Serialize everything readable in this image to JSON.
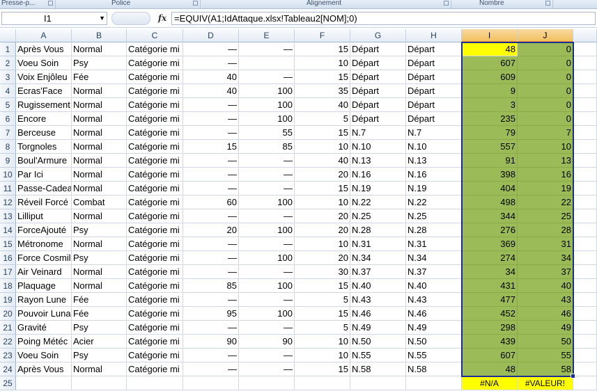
{
  "ribbon": {
    "groups": [
      {
        "label": "Presse-p...",
        "key": "clipboard"
      },
      {
        "label": "Police",
        "key": "font"
      },
      {
        "label": "Alignement",
        "key": "alignment"
      },
      {
        "label": "Nombre",
        "key": "number"
      }
    ]
  },
  "formula_bar": {
    "name_box": "I1",
    "fx_label": "fx",
    "formula": "=EQUIV(A1;IdAttaque.xlsx!Tableau2[NOM];0)"
  },
  "sheet": {
    "columns": [
      "A",
      "B",
      "C",
      "D",
      "E",
      "F",
      "G",
      "H",
      "I",
      "J"
    ],
    "selected_column": "I",
    "rows": [
      {
        "n": "1",
        "A": "Après Vous",
        "B": "Normal",
        "C": "Catégorie mi",
        "D": "—",
        "E": "—",
        "F": "15",
        "G": "Départ",
        "H": "Départ",
        "I": "48",
        "J": "0"
      },
      {
        "n": "2",
        "A": "Voeu Soin",
        "B": "Psy",
        "C": "Catégorie mi",
        "D": "—",
        "E": "",
        "F": "10",
        "G": "Départ",
        "H": "Départ",
        "I": "607",
        "J": "0"
      },
      {
        "n": "3",
        "A": "Voix Enjôleu",
        "B": "Fée",
        "C": "Catégorie mi",
        "D": "40",
        "E": "—",
        "F": "15",
        "G": "Départ",
        "H": "Départ",
        "I": "609",
        "J": "0"
      },
      {
        "n": "4",
        "A": "Ecras'Face",
        "B": "Normal",
        "C": "Catégorie mi",
        "D": "40",
        "E": "100",
        "F": "35",
        "G": "Départ",
        "H": "Départ",
        "I": "9",
        "J": "0"
      },
      {
        "n": "5",
        "A": "Rugissement",
        "B": "Normal",
        "C": "Catégorie mi",
        "D": "—",
        "E": "100",
        "F": "40",
        "G": "Départ",
        "H": "Départ",
        "I": "3",
        "J": "0"
      },
      {
        "n": "6",
        "A": "Encore",
        "B": "Normal",
        "C": "Catégorie mi",
        "D": "—",
        "E": "100",
        "F": "5",
        "G": "Départ",
        "H": "Départ",
        "I": "235",
        "J": "0"
      },
      {
        "n": "7",
        "A": "Berceuse",
        "B": "Normal",
        "C": "Catégorie mi",
        "D": "—",
        "E": "55",
        "F": "15",
        "G": "N.7",
        "H": "N.7",
        "I": "79",
        "J": "7"
      },
      {
        "n": "8",
        "A": "Torgnoles",
        "B": "Normal",
        "C": "Catégorie mi",
        "D": "15",
        "E": "85",
        "F": "10",
        "G": "N.10",
        "H": "N.10",
        "I": "557",
        "J": "10"
      },
      {
        "n": "9",
        "A": "Boul'Armure",
        "B": "Normal",
        "C": "Catégorie mi",
        "D": "—",
        "E": "—",
        "F": "40",
        "G": "N.13",
        "H": "N.13",
        "I": "91",
        "J": "13"
      },
      {
        "n": "10",
        "A": "Par Ici",
        "B": "Normal",
        "C": "Catégorie mi",
        "D": "—",
        "E": "—",
        "F": "20",
        "G": "N.16",
        "H": "N.16",
        "I": "398",
        "J": "16"
      },
      {
        "n": "11",
        "A": "Passe-Cadea",
        "B": "Normal",
        "C": "Catégorie mi",
        "D": "—",
        "E": "—",
        "F": "15",
        "G": "N.19",
        "H": "N.19",
        "I": "404",
        "J": "19"
      },
      {
        "n": "12",
        "A": "Réveil Forcé",
        "B": "Combat",
        "C": "Catégorie mi",
        "D": "60",
        "E": "100",
        "F": "10",
        "G": "N.22",
        "H": "N.22",
        "I": "498",
        "J": "22"
      },
      {
        "n": "13",
        "A": "Lilliput",
        "B": "Normal",
        "C": "Catégorie mi",
        "D": "—",
        "E": "—",
        "F": "20",
        "G": "N.25",
        "H": "N.25",
        "I": "344",
        "J": "25"
      },
      {
        "n": "14",
        "A": "ForceAjouté",
        "B": "Psy",
        "C": "Catégorie mi",
        "D": "20",
        "E": "100",
        "F": "20",
        "G": "N.28",
        "H": "N.28",
        "I": "276",
        "J": "28"
      },
      {
        "n": "15",
        "A": "Métronome",
        "B": "Normal",
        "C": "Catégorie mi",
        "D": "—",
        "E": "—",
        "F": "10",
        "G": "N.31",
        "H": "N.31",
        "I": "369",
        "J": "31"
      },
      {
        "n": "16",
        "A": "Force Cosmil",
        "B": "Psy",
        "C": "Catégorie mi",
        "D": "—",
        "E": "100",
        "F": "20",
        "G": "N.34",
        "H": "N.34",
        "I": "274",
        "J": "34"
      },
      {
        "n": "17",
        "A": "Air Veinard",
        "B": "Normal",
        "C": "Catégorie mi",
        "D": "—",
        "E": "—",
        "F": "30",
        "G": "N.37",
        "H": "N.37",
        "I": "34",
        "J": "37"
      },
      {
        "n": "18",
        "A": "Plaquage",
        "B": "Normal",
        "C": "Catégorie mi",
        "D": "85",
        "E": "100",
        "F": "15",
        "G": "N.40",
        "H": "N.40",
        "I": "431",
        "J": "40"
      },
      {
        "n": "19",
        "A": "Rayon Lune",
        "B": "Fée",
        "C": "Catégorie mi",
        "D": "—",
        "E": "—",
        "F": "5",
        "G": "N.43",
        "H": "N.43",
        "I": "477",
        "J": "43"
      },
      {
        "n": "20",
        "A": "Pouvoir Luna",
        "B": "Fée",
        "C": "Catégorie mi",
        "D": "95",
        "E": "100",
        "F": "15",
        "G": "N.46",
        "H": "N.46",
        "I": "452",
        "J": "46"
      },
      {
        "n": "21",
        "A": "Gravité",
        "B": "Psy",
        "C": "Catégorie mi",
        "D": "—",
        "E": "—",
        "F": "5",
        "G": "N.49",
        "H": "N.49",
        "I": "298",
        "J": "49"
      },
      {
        "n": "22",
        "A": "Poing Météc",
        "B": "Acier",
        "C": "Catégorie mi",
        "D": "90",
        "E": "90",
        "F": "10",
        "G": "N.50",
        "H": "N.50",
        "I": "439",
        "J": "50"
      },
      {
        "n": "23",
        "A": "Voeu Soin",
        "B": "Psy",
        "C": "Catégorie mi",
        "D": "—",
        "E": "—",
        "F": "10",
        "G": "N.55",
        "H": "N.55",
        "I": "607",
        "J": "55"
      },
      {
        "n": "24",
        "A": "Après Vous",
        "B": "Normal",
        "C": "Catégorie mi",
        "D": "—",
        "E": "—",
        "F": "15",
        "G": "N.58",
        "H": "N.58",
        "I": "48",
        "J": "58"
      },
      {
        "n": "25",
        "A": "",
        "B": "",
        "C": "",
        "D": "",
        "E": "",
        "F": "",
        "G": "",
        "H": "",
        "I": "#N/A",
        "J": "#VALEUR!"
      }
    ]
  },
  "colors": {
    "fill_green": "#9bbb59",
    "fill_yellow": "#ffff00",
    "selection_border": "#1a2f8f"
  }
}
